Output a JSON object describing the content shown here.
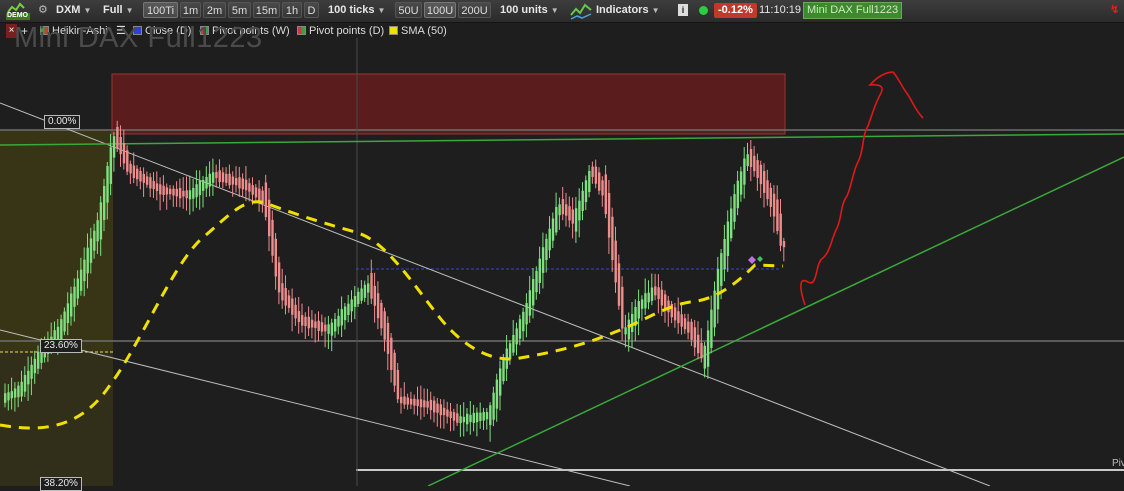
{
  "toolbar": {
    "demo_badge": "DEMO",
    "instrument": "DXM",
    "chart_mode": "Full",
    "timeframes": [
      "100Ti",
      "1m",
      "2m",
      "5m",
      "15m",
      "1h",
      "D"
    ],
    "ticks_select": "100 ticks",
    "units_buttons": [
      "50U",
      "100U",
      "200U"
    ],
    "units_select": "100 units",
    "indicators_label": "Indicators",
    "change_pct": "-0.12%",
    "time": "11:10:19",
    "instrument_full": "Mini DAX Full1223",
    "colors": {
      "change_bg": "#c0392b",
      "connected_dot": "#2ecc40",
      "instrument_tag_bg": "#3c8a2c"
    }
  },
  "legend": {
    "items": [
      {
        "label": "Heikin-Ashi",
        "swatch": [
          "#3aa13a",
          "#cc3b3b"
        ]
      },
      {
        "label": "Close (D)",
        "swatch": [
          "#2e3fd6"
        ]
      },
      {
        "label": "Pivot points (W)",
        "swatch": [
          "#cc3b3b",
          "#3aa13a"
        ]
      },
      {
        "label": "Pivot points (D)",
        "swatch": [
          "#cc3b3b",
          "#3aa13a"
        ]
      },
      {
        "label": "SMA (50)",
        "swatch": [
          "#f0e000"
        ]
      }
    ]
  },
  "chart": {
    "watermark": "Mini DAX Full1223",
    "fib_labels": [
      "0.00%",
      "23.60%",
      "38.20%"
    ],
    "pivot_label": "Piv",
    "colors": {
      "bull": "#7fe07f",
      "bear": "#ef8d8d",
      "sma": "#f0e000",
      "trend": "#3aa83a",
      "drawing": "#e01818",
      "zone": "#7a1f1f"
    }
  }
}
